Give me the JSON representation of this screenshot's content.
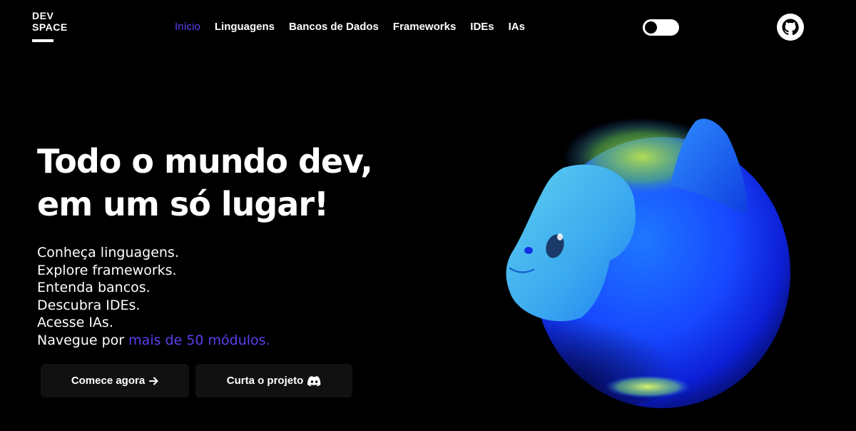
{
  "brand": {
    "line1": "DEV",
    "line2": "SPACE"
  },
  "nav": {
    "items": [
      {
        "label": "Início",
        "active": true
      },
      {
        "label": "Linguagens"
      },
      {
        "label": "Bancos de Dados"
      },
      {
        "label": "Frameworks"
      },
      {
        "label": "IDEs"
      },
      {
        "label": "IAs"
      }
    ]
  },
  "theme_toggle": {
    "icon": "toggle-icon",
    "state": "dark"
  },
  "github": {
    "icon": "github-icon"
  },
  "hero": {
    "title_line1": "Todo o mundo dev,",
    "title_line2": "em um só lugar!",
    "taglines": [
      "Conheça linguagens.",
      "Explore frameworks.",
      "Entenda bancos.",
      "Descubra IDEs.",
      "Acesse IAs."
    ],
    "last_line_prefix": "Navegue por ",
    "last_line_accent": "mais de 50 módulos."
  },
  "buttons": {
    "start_label": "Comece agora",
    "start_icon": "arrow-right-icon",
    "discord_label": "Curta o projeto",
    "discord_icon": "discord-icon"
  },
  "colors": {
    "background": "#000000",
    "accent": "#5b3ff0",
    "button_bg": "#111111",
    "text": "#ffffff"
  }
}
